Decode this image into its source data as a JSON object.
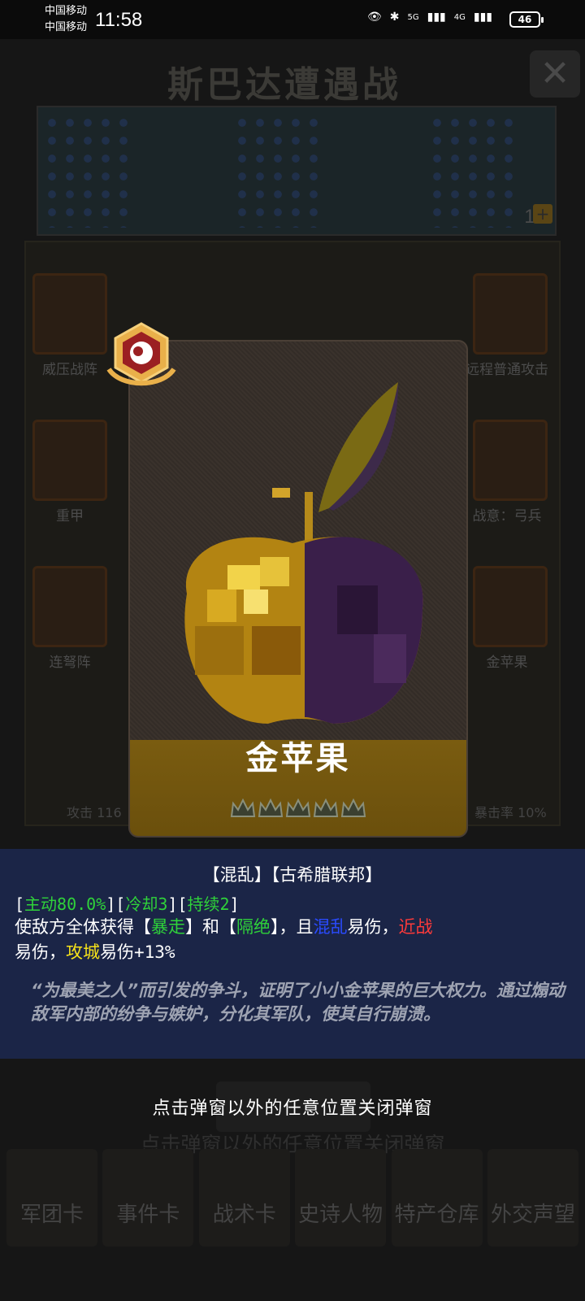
{
  "status_bar": {
    "carrier_1": "中国移动",
    "carrier_2": "中国移动",
    "time": "11:58",
    "battery": "46",
    "network_1": "5G",
    "network_2": "4G"
  },
  "background": {
    "title": "斯巴达遭遇战",
    "troop_count": "18",
    "card_labels": [
      "威压战阵",
      "远程普通攻击",
      "重甲",
      "战意：弓兵",
      "连弩阵",
      "金苹果"
    ],
    "stats": {
      "attack": "攻击 116",
      "crit_rate": "暴击率 10%"
    },
    "tabs": [
      "军团卡",
      "事件卡",
      "战术卡",
      "史诗人物",
      "特产仓库",
      "外交声望"
    ],
    "close_hint": "点击弹窗以外的任意位置关闭弹窗"
  },
  "card": {
    "name": "金苹果",
    "stars": 5,
    "badge_icon": "eye-of-discord-icon",
    "accent_color": "#7a5c10"
  },
  "description": {
    "tags": "【混乱】【古希腊联邦】",
    "stats_parts": [
      "主动80.0%",
      "冷却3",
      "持续2"
    ],
    "effect_line1": {
      "a": "使敌方全体获得【",
      "b": "暴走",
      "c": "】和【",
      "d": "隔绝",
      "e": "】，且",
      "f": "混乱",
      "g": "易伤，",
      "h": "近战"
    },
    "effect_line2": {
      "a": "易伤，",
      "b": "攻城",
      "c": "易伤+13%"
    },
    "flavor": "“为最美之人”而引发的争斗，证明了小小金苹果的巨大权力。通过煽动敌军内部的纷争与嫉妒，分化其军队，使其自行崩溃。"
  },
  "close_hint": "点击弹窗以外的任意位置关闭弹窗"
}
